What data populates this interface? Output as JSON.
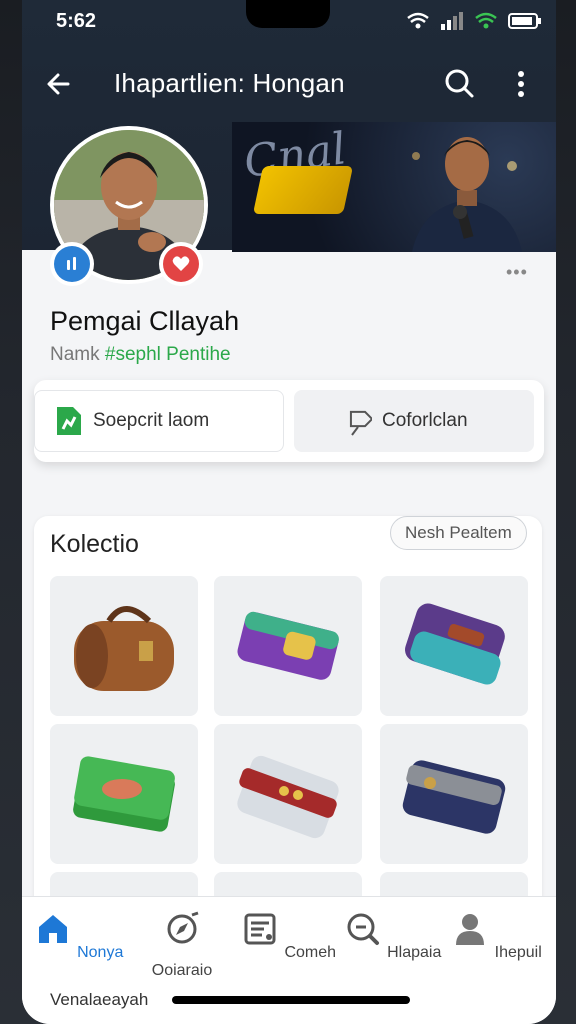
{
  "status": {
    "time": "5:62"
  },
  "topbar": {
    "title": "Ihapartlien: Hongan"
  },
  "cover": {
    "text": "Cnal"
  },
  "profile": {
    "name": "Pemgai Cllayah",
    "sub_prefix": "Namk ",
    "sub_highlight": "#sephl Pentihe",
    "more": "•••"
  },
  "actions": {
    "primary_label": "Soepcrit laom",
    "secondary_label": "Coforlclan"
  },
  "collection": {
    "title": "Kolectio",
    "link_label": "Nesh Pealtem",
    "items": [
      {
        "name": "brown-leather-bag",
        "color": "#9b5a2c"
      },
      {
        "name": "purple-gold-wallet",
        "color": "#7b3fb2"
      },
      {
        "name": "purple-teal-wallet",
        "color": "#5b3b8a"
      },
      {
        "name": "green-wallet",
        "color": "#2f9a3c"
      },
      {
        "name": "white-red-wallet",
        "color": "#d8dde3"
      },
      {
        "name": "navy-wallet",
        "color": "#2c3566"
      }
    ]
  },
  "nav": {
    "items": [
      {
        "label": "Nonya",
        "icon": "home-icon",
        "active": true
      },
      {
        "label": "Ooiaraio",
        "icon": "compass-icon",
        "active": false
      },
      {
        "label": "Comeh",
        "icon": "list-icon",
        "active": false
      },
      {
        "label": "Hlapaia",
        "icon": "search-icon",
        "active": false
      },
      {
        "label": "Ihepuil",
        "icon": "profile-icon",
        "active": false
      }
    ]
  },
  "caption": "Venalaeayah",
  "colors": {
    "accent": "#1e78d6",
    "green": "#2ba84a",
    "red": "#e24444"
  }
}
